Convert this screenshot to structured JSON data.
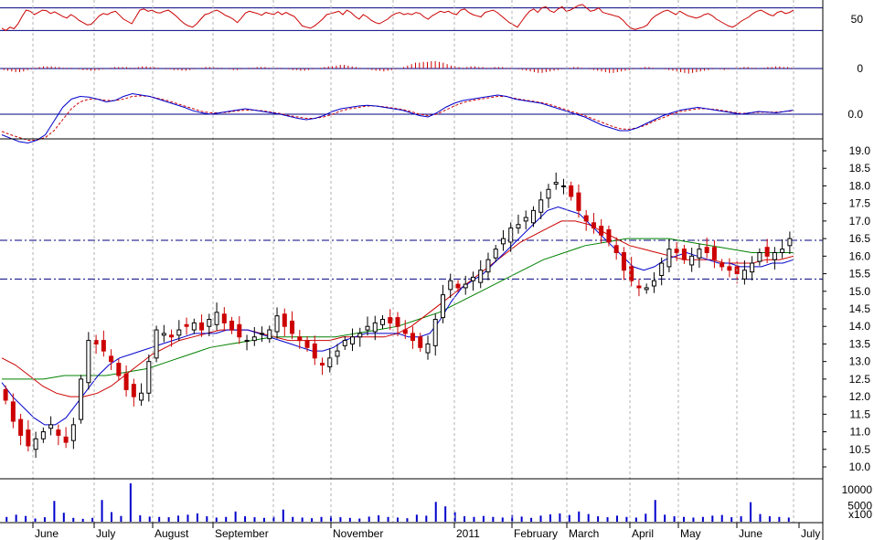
{
  "chart_data": [
    {
      "type": "line",
      "panel": "rsi",
      "y_ticks": [
        "50"
      ],
      "levels": [
        70,
        30
      ],
      "ylim": [
        0,
        100
      ],
      "colors": {
        "line": "#cc0000",
        "level": "#000080"
      },
      "series": [
        {
          "values": [
            34,
            30,
            36,
            33,
            42,
            55,
            66,
            64,
            58,
            62,
            66,
            65,
            60,
            63,
            59,
            55,
            52,
            58,
            54,
            48,
            44,
            40,
            41,
            48,
            56,
            60,
            58,
            62,
            64,
            57,
            50,
            46,
            42,
            54,
            66,
            68,
            64,
            66,
            62,
            61,
            64,
            66,
            61,
            55,
            48,
            42,
            38,
            36,
            42,
            50,
            58,
            60,
            64,
            66,
            62,
            57,
            54,
            50,
            44,
            52,
            61,
            64,
            62,
            60,
            57,
            62,
            60,
            58,
            63,
            58,
            62,
            58,
            55,
            47,
            38,
            36,
            34,
            38,
            44,
            50,
            58,
            60,
            62,
            64,
            58,
            66,
            62,
            55,
            50,
            58,
            54,
            48,
            44,
            42,
            46,
            50,
            56,
            60,
            62,
            58,
            60,
            58,
            62,
            60,
            54,
            50,
            56,
            60,
            64,
            62,
            64,
            60,
            58,
            66,
            68,
            62,
            58,
            56,
            54,
            62,
            64,
            66,
            62,
            56,
            50,
            44,
            40,
            36,
            46,
            56,
            64,
            68,
            62,
            70,
            72,
            65,
            62,
            68,
            72,
            64,
            66,
            70,
            74,
            76,
            70,
            64,
            66,
            70,
            62,
            60,
            58,
            56,
            54,
            48,
            40,
            34,
            32,
            34,
            36,
            40,
            50,
            56,
            60,
            64,
            66,
            62,
            58,
            64,
            60,
            56,
            54,
            52,
            54,
            58,
            60,
            56,
            50,
            46,
            42,
            38,
            36,
            40,
            46,
            50,
            54,
            60,
            64,
            66,
            62,
            58,
            56,
            62,
            64,
            60,
            62,
            66
          ]
        }
      ]
    },
    {
      "type": "bar",
      "panel": "macd-histogram",
      "y_ticks": [
        "0"
      ],
      "colors": {
        "bar": "#cc0000",
        "zero": "#000080"
      },
      "values": [
        -2,
        -3,
        -4,
        -5,
        -5,
        -4,
        -2,
        -1,
        1,
        2,
        3,
        3,
        3,
        2,
        2,
        1,
        1,
        1,
        0,
        -1,
        -2,
        -2,
        -3,
        -3,
        -2,
        -1,
        0,
        1,
        2,
        2,
        2,
        2,
        1,
        1,
        2,
        3,
        3,
        2,
        2,
        1,
        0,
        -1,
        -1,
        -2,
        -2,
        -3,
        -3,
        -2,
        -1,
        0,
        1,
        2,
        2,
        2,
        1,
        1,
        0,
        -1,
        -2,
        -2,
        -1,
        0,
        1,
        1,
        2,
        2,
        2,
        1,
        1,
        1,
        1,
        0,
        -1,
        -2,
        -2,
        -3,
        -3,
        -2,
        -1,
        0,
        1,
        2,
        3,
        3,
        4,
        5,
        5,
        4,
        3,
        2,
        1,
        0,
        -1,
        -2,
        -3,
        -3,
        -4,
        -3,
        -2,
        -1,
        0,
        2,
        4,
        6,
        8,
        8,
        9,
        9,
        10,
        10,
        9,
        8,
        6,
        4,
        3,
        2,
        1,
        2,
        3,
        3,
        2,
        2,
        1,
        1,
        2,
        2,
        2,
        1,
        1,
        0,
        -1,
        -2,
        -3,
        -4,
        -5,
        -6,
        -6,
        -5,
        -4,
        -3,
        -2,
        -1,
        0,
        1,
        2,
        2,
        1,
        0,
        -1,
        -2,
        -3,
        -4,
        -5,
        -6,
        -6,
        -5,
        -4,
        -3,
        -2,
        -1,
        0,
        1,
        2,
        2,
        1,
        0,
        0,
        -1,
        -2,
        -3,
        -4,
        -5,
        -6,
        -7,
        -6,
        -5,
        -4,
        -3,
        -2,
        -1,
        0,
        -1,
        -2,
        -1,
        0,
        1,
        1,
        2,
        2,
        1,
        1,
        0,
        1,
        2,
        2,
        3,
        3,
        2,
        2,
        1
      ]
    },
    {
      "type": "line",
      "panel": "macd",
      "y_ticks": [
        "0.0"
      ],
      "colors": {
        "macd": "#0000cc",
        "signal": "#cc0000",
        "zero": "#000080"
      },
      "series": [
        {
          "values": [
            -0.3,
            -0.35,
            -0.4,
            -0.42,
            -0.38,
            -0.3,
            -0.1,
            0.1,
            0.22,
            0.26,
            0.25,
            0.22,
            0.18,
            0.2,
            0.26,
            0.3,
            0.28,
            0.26,
            0.22,
            0.18,
            0.14,
            0.1,
            0.05,
            0.02,
            0.0,
            0.02,
            0.04,
            0.06,
            0.08,
            0.06,
            0.04,
            0.02,
            0.0,
            -0.03,
            -0.06,
            -0.08,
            -0.06,
            -0.02,
            0.04,
            0.08,
            0.1,
            0.12,
            0.13,
            0.12,
            0.1,
            0.08,
            0.06,
            0.02,
            -0.02,
            -0.04,
            0.02,
            0.1,
            0.16,
            0.2,
            0.22,
            0.24,
            0.26,
            0.28,
            0.26,
            0.22,
            0.2,
            0.18,
            0.16,
            0.12,
            0.08,
            0.04,
            0.0,
            -0.04,
            -0.1,
            -0.16,
            -0.2,
            -0.24,
            -0.24,
            -0.2,
            -0.14,
            -0.08,
            -0.02,
            0.02,
            0.06,
            0.08,
            0.1,
            0.08,
            0.06,
            0.04,
            0.02,
            0.0,
            0.02,
            0.04,
            0.03,
            0.02,
            0.04,
            0.06
          ]
        },
        {
          "values": [
            -0.25,
            -0.3,
            -0.34,
            -0.38,
            -0.38,
            -0.34,
            -0.24,
            -0.08,
            0.08,
            0.18,
            0.22,
            0.22,
            0.2,
            0.2,
            0.22,
            0.26,
            0.27,
            0.26,
            0.23,
            0.2,
            0.16,
            0.12,
            0.08,
            0.04,
            0.02,
            0.02,
            0.03,
            0.05,
            0.06,
            0.06,
            0.05,
            0.03,
            0.01,
            -0.02,
            -0.04,
            -0.06,
            -0.06,
            -0.04,
            0.0,
            0.05,
            0.08,
            0.1,
            0.12,
            0.12,
            0.11,
            0.09,
            0.07,
            0.04,
            0.0,
            -0.02,
            0.0,
            0.06,
            0.12,
            0.17,
            0.2,
            0.22,
            0.24,
            0.26,
            0.26,
            0.23,
            0.21,
            0.19,
            0.17,
            0.14,
            0.1,
            0.06,
            0.02,
            -0.02,
            -0.07,
            -0.12,
            -0.17,
            -0.21,
            -0.22,
            -0.2,
            -0.16,
            -0.1,
            -0.05,
            0.0,
            0.04,
            0.06,
            0.08,
            0.08,
            0.07,
            0.05,
            0.03,
            0.01,
            0.02,
            0.03,
            0.03,
            0.03,
            0.04,
            0.05
          ]
        }
      ]
    },
    {
      "type": "candlestick",
      "panel": "price",
      "ylim": [
        9.75,
        19.25
      ],
      "y_ticks": [
        "10.0",
        "10.5",
        "11.0",
        "11.5",
        "12.0",
        "12.5",
        "13.0",
        "13.5",
        "14.0",
        "14.5",
        "15.0",
        "15.5",
        "16.0",
        "16.5",
        "17.0",
        "17.5",
        "18.0",
        "18.5",
        "19.0"
      ],
      "x_months": [
        "June",
        "July",
        "August",
        "September",
        "November",
        "2011",
        "February",
        "March",
        "April",
        "May",
        "June",
        "July"
      ],
      "levels": [
        16.45,
        15.35
      ],
      "colors": {
        "up": "#000000",
        "down": "#cc0000",
        "ma_short": "#0000cc",
        "ma_mid": "#cc0000",
        "ma_long": "#008000",
        "level": "#000080"
      },
      "close": [
        11.9,
        11.3,
        10.9,
        10.6,
        10.8,
        11.0,
        11.2,
        10.9,
        10.7,
        11.2,
        12.5,
        13.6,
        13.5,
        13.3,
        13.0,
        12.6,
        12.2,
        12.0,
        12.1,
        13.0,
        13.9,
        13.8,
        13.7,
        13.9,
        14.0,
        14.1,
        13.9,
        14.2,
        14.4,
        14.1,
        13.9,
        13.7,
        13.6,
        13.7,
        13.8,
        13.9,
        14.3,
        14.0,
        13.8,
        13.6,
        13.4,
        13.1,
        12.9,
        13.1,
        13.3,
        13.6,
        13.7,
        13.8,
        14.0,
        14.1,
        14.2,
        14.1,
        14.0,
        13.8,
        13.6,
        13.4,
        13.5,
        14.2,
        14.9,
        15.3,
        15.1,
        15.2,
        15.4,
        15.6,
        15.9,
        16.2,
        16.5,
        16.8,
        16.9,
        17.1,
        17.3,
        17.6,
        17.9,
        18.1,
        18.0,
        17.7,
        17.3,
        17.0,
        16.8,
        16.6,
        16.4,
        16.1,
        15.6,
        15.3,
        15.1,
        15.1,
        15.3,
        15.8,
        16.2,
        16.1,
        15.9,
        16.0,
        16.2,
        16.1,
        15.9,
        15.7,
        15.6,
        15.5,
        15.6,
        15.8,
        16.1,
        16.0,
        16.1,
        16.2,
        16.5
      ],
      "ma_short": [
        12.4,
        12.0,
        11.7,
        11.4,
        11.2,
        11.2,
        11.4,
        11.8,
        12.2,
        12.6,
        12.9,
        13.1,
        13.2,
        13.3,
        13.4,
        13.5,
        13.6,
        13.7,
        13.8,
        13.8,
        13.8,
        13.9,
        13.9,
        13.9,
        13.8,
        13.7,
        13.6,
        13.5,
        13.4,
        13.3,
        13.3,
        13.4,
        13.6,
        13.7,
        13.8,
        13.8,
        13.8,
        13.8,
        13.7,
        13.7,
        13.8,
        14.2,
        14.7,
        15.1,
        15.3,
        15.5,
        15.8,
        16.1,
        16.4,
        16.7,
        17.0,
        17.3,
        17.4,
        17.3,
        17.2,
        16.9,
        16.6,
        16.3,
        16.0,
        15.7,
        15.6,
        15.7,
        15.9,
        16.0,
        16.1,
        16.0,
        15.9,
        15.8,
        15.8,
        15.7,
        15.7,
        15.7,
        15.8,
        15.8,
        15.9
      ],
      "ma_mid": [
        13.1,
        12.9,
        12.6,
        12.3,
        12.1,
        12.0,
        12.0,
        12.1,
        12.3,
        12.6,
        12.9,
        13.2,
        13.4,
        13.6,
        13.7,
        13.8,
        13.9,
        13.9,
        13.9,
        13.8,
        13.7,
        13.6,
        13.6,
        13.6,
        13.6,
        13.7,
        13.7,
        13.7,
        13.7,
        13.8,
        14.0,
        14.3,
        14.6,
        14.9,
        15.2,
        15.5,
        15.8,
        16.1,
        16.4,
        16.6,
        16.8,
        17.0,
        17.0,
        16.9,
        16.7,
        16.5,
        16.3,
        16.2,
        16.1,
        16.0,
        15.9,
        15.9,
        15.9,
        15.8,
        15.8,
        15.8,
        15.9,
        15.9,
        16.0
      ],
      "ma_long": [
        12.5,
        12.5,
        12.5,
        12.6,
        12.6,
        12.6,
        12.7,
        12.8,
        13.0,
        13.2,
        13.4,
        13.5,
        13.6,
        13.7,
        13.7,
        13.7,
        13.7,
        13.8,
        13.9,
        14.0,
        14.2,
        14.4,
        14.7,
        15.0,
        15.3,
        15.6,
        15.9,
        16.1,
        16.3,
        16.4,
        16.5,
        16.5,
        16.5,
        16.4,
        16.3,
        16.2,
        16.1,
        16.1,
        16.1
      ]
    },
    {
      "type": "bar",
      "panel": "volume",
      "y_ticks": [
        "10000",
        "5000"
      ],
      "unit": "x100",
      "colors": {
        "bar": "#0000cc"
      },
      "values": [
        1500,
        2200,
        1800,
        1000,
        1400,
        6500,
        2800,
        1200,
        900,
        1200,
        6800,
        3000,
        1800,
        12000,
        2000,
        1600,
        1500,
        1400,
        1900,
        2200,
        2600,
        1700,
        1300,
        1500,
        3200,
        1700,
        1400,
        1200,
        1600,
        3800,
        1500,
        1300,
        1100,
        1500,
        1800,
        1400,
        1200,
        1000,
        1600,
        2000,
        1500,
        1300,
        1100,
        2200,
        1900,
        6200,
        4800,
        3000,
        1700,
        1500,
        1800,
        1500,
        1300,
        2100,
        1600,
        1200,
        1900,
        2300,
        2600,
        2100,
        3200,
        2400,
        1700,
        1400,
        1900,
        1500,
        1300,
        2500,
        6800,
        2200,
        1700,
        1500,
        1300,
        1500,
        1900,
        2100,
        1400,
        1700,
        6100,
        2400,
        1700,
        1500,
        1300
      ]
    }
  ]
}
